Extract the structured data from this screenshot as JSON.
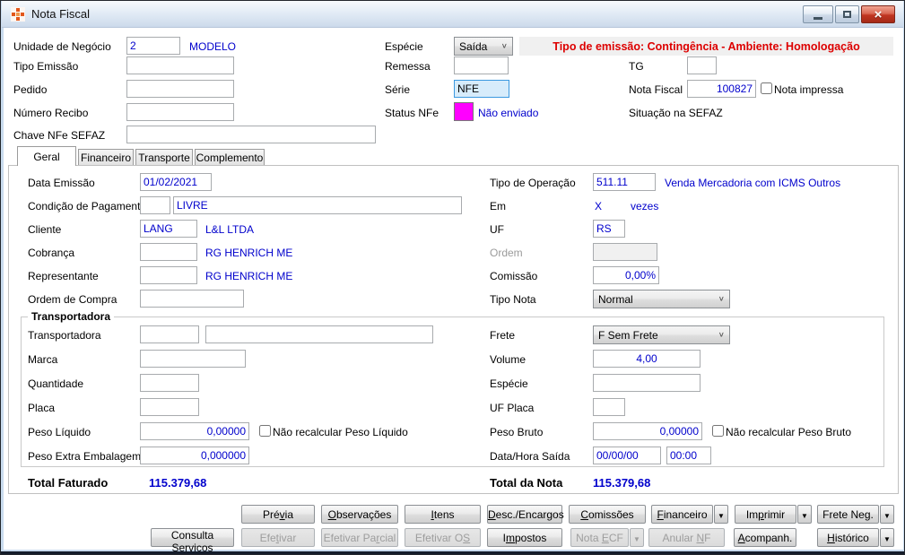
{
  "colors": {
    "value-blue": "#0000cc",
    "banner-red": "#dd0000",
    "status-magenta": "#ff00ff",
    "focus-bg": "#d7ecfb",
    "focus-border": "#3c99e0"
  },
  "window": {
    "title": "Nota Fiscal"
  },
  "banner": {
    "text": "Tipo de emissão: Contingência - Ambiente: Homologação"
  },
  "header": {
    "unidade": {
      "label": "Unidade de Negócio",
      "value": "2",
      "name": "MODELO"
    },
    "especie": {
      "label": "Espécie",
      "value": "Saída"
    },
    "tipo_emissao": {
      "label": "Tipo Emissão",
      "value": ""
    },
    "remessa": {
      "label": "Remessa",
      "value": ""
    },
    "tg": {
      "label": "TG",
      "value": ""
    },
    "pedido": {
      "label": "Pedido",
      "value": ""
    },
    "serie": {
      "label": "Série",
      "value": "NFE"
    },
    "nota_fiscal": {
      "label": "Nota Fiscal",
      "value": "100827"
    },
    "nota_impressa": {
      "label": "Nota impressa",
      "checked": false
    },
    "numero_recibo": {
      "label": "Número Recibo",
      "value": ""
    },
    "status_nfe": {
      "label": "Status NFe",
      "text": "Não enviado"
    },
    "situacao_sefaz": {
      "label": "Situação na SEFAZ"
    },
    "chave": {
      "label": "Chave NFe SEFAZ",
      "value": ""
    }
  },
  "tabs": {
    "geral": "Geral",
    "financeiro": "Financeiro",
    "transporte": "Transporte",
    "complemento": "Complemento"
  },
  "geral": {
    "data_emissao": {
      "label": "Data Emissão",
      "value": "01/02/2021"
    },
    "cond_pagamento": {
      "label": "Condição de Pagamento",
      "code": "",
      "value": "LIVRE"
    },
    "cliente": {
      "label": "Cliente",
      "code": "LANG",
      "name": "L&L LTDA"
    },
    "cobranca": {
      "label": "Cobrança",
      "code": "",
      "name": "RG HENRICH ME"
    },
    "representante": {
      "label": "Representante",
      "code": "",
      "name": "RG HENRICH ME"
    },
    "ordem_compra": {
      "label": "Ordem de Compra",
      "value": ""
    },
    "tipo_operacao": {
      "label": "Tipo de Operação",
      "code": "511.11",
      "name": "Venda Mercadoria com ICMS Outros"
    },
    "em": {
      "label": "Em",
      "value": "X",
      "suffix": "vezes"
    },
    "uf": {
      "label": "UF",
      "value": "RS"
    },
    "ordem": {
      "label": "Ordem",
      "value": ""
    },
    "comissao": {
      "label": "Comissão",
      "value": "0,00%"
    },
    "tipo_nota": {
      "label": "Tipo Nota",
      "value": "Normal"
    }
  },
  "transportadora": {
    "title": "Transportadora",
    "transportadora": {
      "label": "Transportadora",
      "code": "",
      "name": ""
    },
    "marca": {
      "label": "Marca",
      "value": ""
    },
    "quantidade": {
      "label": "Quantidade",
      "value": ""
    },
    "placa": {
      "label": "Placa",
      "value": ""
    },
    "peso_liquido": {
      "label": "Peso Líquido",
      "value": "0,00000",
      "checkbox": "Não recalcular Peso Líquido",
      "checked": false
    },
    "peso_extra": {
      "label": "Peso Extra Embalagem",
      "value": "0,000000"
    },
    "frete": {
      "label": "Frete",
      "value": "F Sem Frete"
    },
    "volume": {
      "label": "Volume",
      "value": "4,00"
    },
    "especie": {
      "label": "Espécie",
      "value": ""
    },
    "uf_placa": {
      "label": "UF Placa",
      "value": ""
    },
    "peso_bruto": {
      "label": "Peso Bruto",
      "value": "0,00000",
      "checkbox": "Não recalcular Peso Bruto",
      "checked": false
    },
    "data_saida": {
      "label": "Data/Hora Saída",
      "date": "00/00/00",
      "time": "00:00"
    }
  },
  "totals": {
    "faturado": {
      "label": "Total Faturado",
      "value": "115.379,68"
    },
    "nota": {
      "label": "Total da Nota",
      "value": "115.379,68"
    }
  },
  "buttons": {
    "row1": [
      {
        "id": "previa",
        "label": "Prévia",
        "u": 3,
        "enabled": true
      },
      {
        "id": "observacoes",
        "label": "Observações",
        "u": 0,
        "enabled": true
      },
      {
        "id": "itens",
        "label": "Itens",
        "u": 0,
        "enabled": true
      },
      {
        "id": "desc-encargos",
        "label": "Desc./Encargos",
        "u": 0,
        "enabled": true
      },
      {
        "id": "comissoes",
        "label": "Comissões",
        "u": 0,
        "enabled": true
      },
      {
        "id": "financeiro",
        "label": "Financeiro",
        "u": 0,
        "enabled": true,
        "dropdown": true
      },
      {
        "id": "imprimir",
        "label": "Imprimir",
        "u": 2,
        "enabled": true,
        "dropdown": true
      },
      {
        "id": "frete-neg",
        "label": "Frete Neg.",
        "u": 8,
        "enabled": true,
        "dropdown": true
      }
    ],
    "row2": [
      {
        "id": "consulta-servicos",
        "label": "Consulta Serviços",
        "u": 14,
        "enabled": true
      },
      {
        "id": "efetivar",
        "label": "Efetivar",
        "u": 3,
        "enabled": false
      },
      {
        "id": "efetivar-parcial",
        "label": "Efetivar Parcial",
        "u": 11,
        "enabled": false
      },
      {
        "id": "efetivar-os",
        "label": "Efetivar OS",
        "u": 10,
        "enabled": false
      },
      {
        "id": "impostos",
        "label": "Impostos",
        "u": 1,
        "enabled": true
      },
      {
        "id": "nota-ecf",
        "label": "Nota ECF",
        "u": 5,
        "enabled": false,
        "dropdown": true
      },
      {
        "id": "anular-nf",
        "label": "Anular NF",
        "u": 7,
        "enabled": false
      },
      {
        "id": "acompanh",
        "label": "Acompanh.",
        "u": 0,
        "enabled": true
      },
      {
        "id": "historico",
        "label": "Histórico",
        "u": 0,
        "enabled": true,
        "dropdown": true
      }
    ]
  }
}
